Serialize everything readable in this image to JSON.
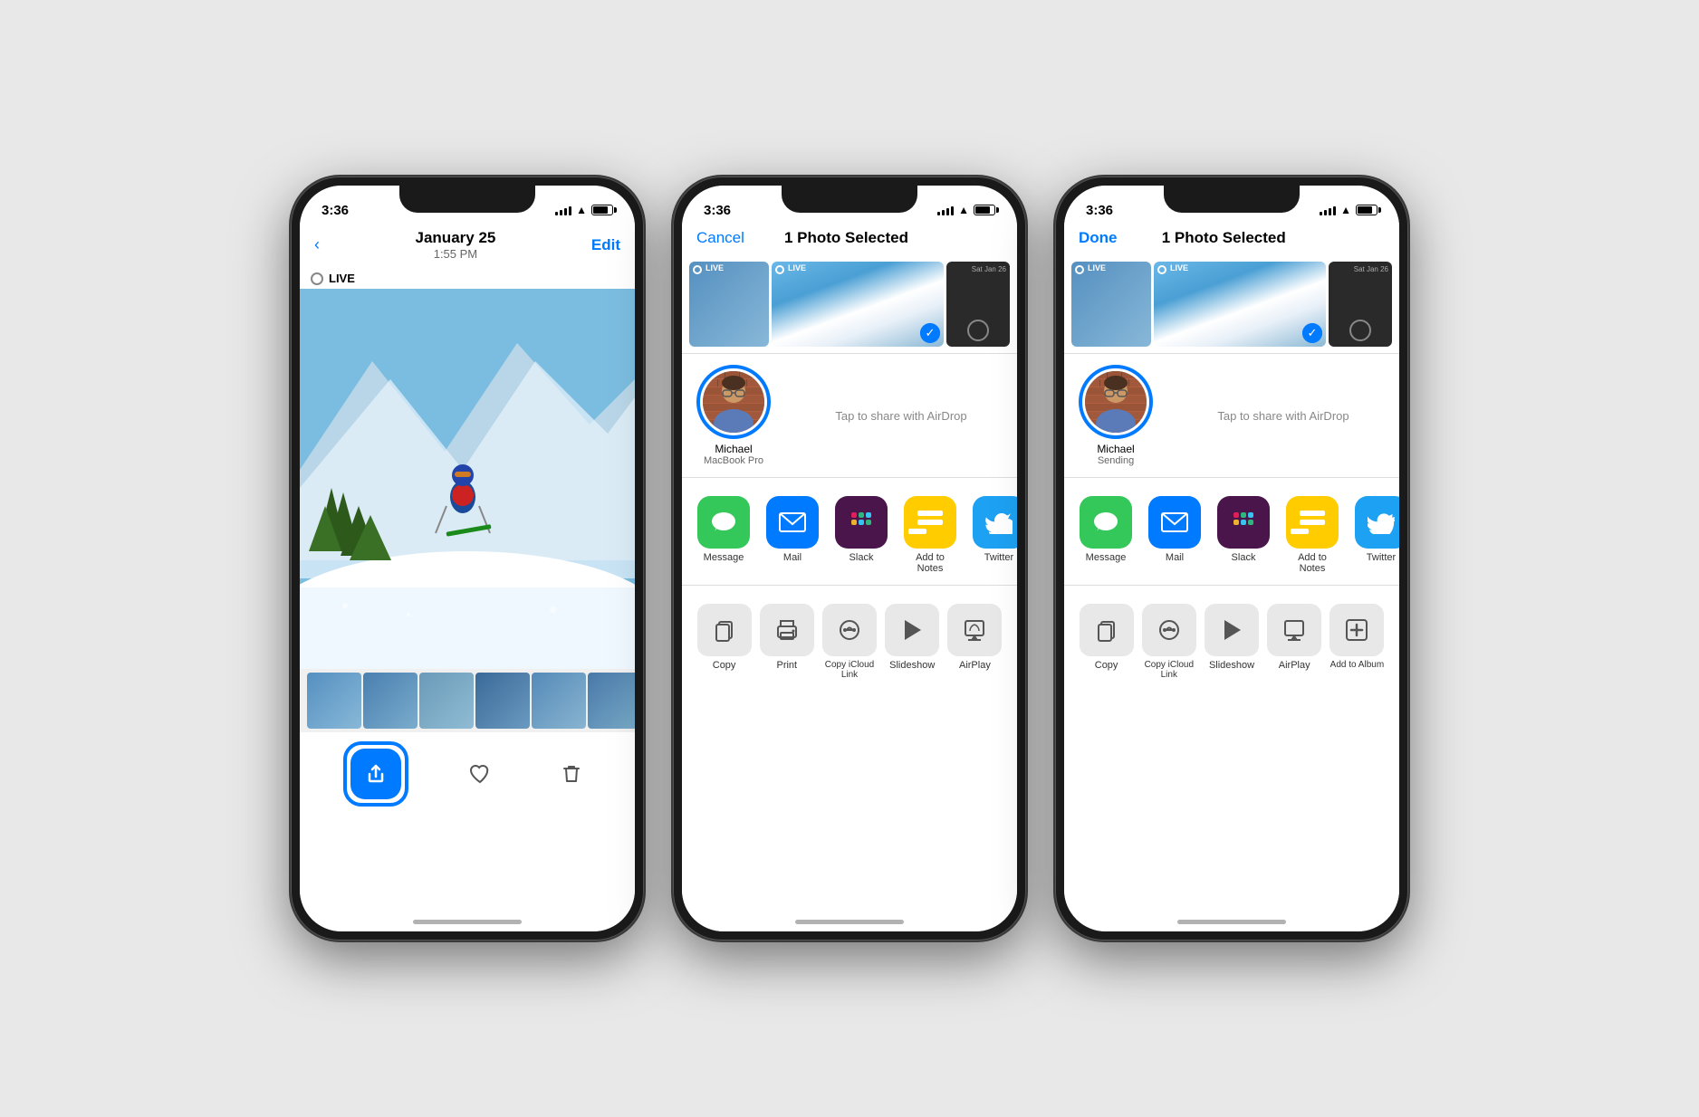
{
  "phones": [
    {
      "id": "phone1",
      "screen": "photo-view",
      "statusBar": {
        "time": "3:36",
        "hasLocation": true
      },
      "navBar": {
        "backLabel": "< ",
        "title": "January 25",
        "subtitle": "1:55 PM",
        "actionLabel": "Edit"
      },
      "liveBadge": "LIVE",
      "toolbarIcons": [
        "heart",
        "trash"
      ],
      "shareButtonHighlighted": true
    },
    {
      "id": "phone2",
      "screen": "share-sheet",
      "statusBar": {
        "time": "3:36",
        "hasLocation": true
      },
      "navBar": {
        "cancelLabel": "Cancel",
        "title": "1 Photo Selected"
      },
      "airdropLabel": "Tap to share with AirDrop",
      "airdropPerson": {
        "name": "Michael",
        "subtitle": "MacBook Pro",
        "highlighted": true
      },
      "appIcons": [
        {
          "name": "Message",
          "color": "#34C759",
          "icon": "💬"
        },
        {
          "name": "Mail",
          "color": "#007AFF",
          "icon": "✉️"
        },
        {
          "name": "Slack",
          "color": "#4A154B",
          "icon": "🔷"
        },
        {
          "name": "Add to Notes",
          "color": "#FFCC00",
          "icon": "📝"
        },
        {
          "name": "Twitter",
          "color": "#1DA1F2",
          "icon": "🐦"
        }
      ],
      "actions": [
        {
          "name": "Copy",
          "icon": "copy"
        },
        {
          "name": "Print",
          "icon": "print"
        },
        {
          "name": "Copy iCloud Link",
          "icon": "link"
        },
        {
          "name": "Slideshow",
          "icon": "play"
        },
        {
          "name": "AirPlay",
          "icon": "airplay"
        }
      ]
    },
    {
      "id": "phone3",
      "screen": "share-sheet-sending",
      "statusBar": {
        "time": "3:36",
        "hasLocation": true
      },
      "navBar": {
        "doneLabel": "Done",
        "title": "1 Photo Selected"
      },
      "airdropLabel": "Tap to share with AirDrop",
      "airdropPerson": {
        "name": "Michael",
        "subtitle": "Sending",
        "highlighted": true
      },
      "appIcons": [
        {
          "name": "Message",
          "color": "#34C759",
          "icon": "💬"
        },
        {
          "name": "Mail",
          "color": "#007AFF",
          "icon": "✉️"
        },
        {
          "name": "Slack",
          "color": "#4A154B",
          "icon": "🔷"
        },
        {
          "name": "Add to Notes",
          "color": "#FFCC00",
          "icon": "📝"
        },
        {
          "name": "Twitter",
          "color": "#1DA1F2",
          "icon": "🐦"
        }
      ],
      "actions": [
        {
          "name": "Copy",
          "icon": "copy"
        },
        {
          "name": "Copy iCloud Link",
          "icon": "link"
        },
        {
          "name": "Slideshow",
          "icon": "play"
        },
        {
          "name": "AirPlay",
          "icon": "airplay"
        },
        {
          "name": "Add to Album",
          "icon": "add"
        }
      ]
    }
  ]
}
